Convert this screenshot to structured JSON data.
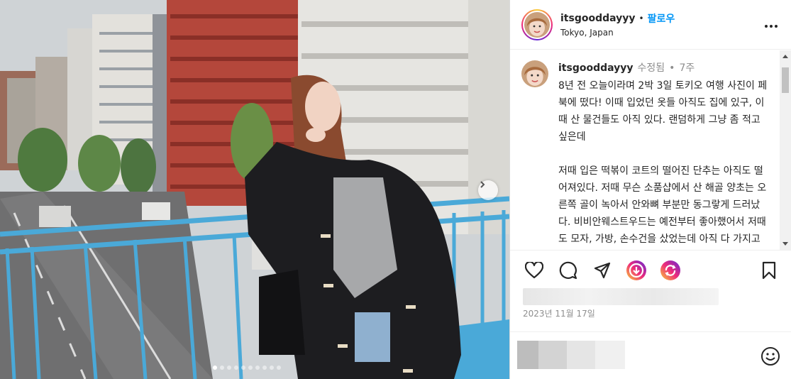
{
  "header": {
    "username": "itsgooddayyy",
    "separator": "•",
    "follow_label": "팔로우",
    "location": "Tokyo, Japan"
  },
  "caption": {
    "username": "itsgooddayyy",
    "edited_label": "수정됨",
    "separator": "•",
    "age": "7주",
    "text": "8년 전 오늘이라며 2박 3일 토키오 여행 사진이 페북에 떴다! 이때 입었던 옷들 아직도 집에 있구, 이때 산 물건들도 아직 있다. 랜덤하게 그냥 좀 적고 싶은데\n\n저때 입은 떡볶이 코트의 떨어진 단추는 아직도 떨어져있다. 저때 무슨 소품샵에서 산 해골 양초는 오른쪽 골이 녹아서 안와뼈 부분만 동그랗게 드러났다. 비비안웨스트우드는 예전부터 좋아했어서 저때도 모자, 가방, 손수건을 샀었는데 아직 다 가지고 있다."
  },
  "post": {
    "date": "2023년 11월 17일"
  },
  "carousel": {
    "total": 10,
    "active": 0
  },
  "icons": {
    "more": "more-horizontal-icon",
    "like": "heart-icon",
    "comment": "comment-icon",
    "share": "send-icon",
    "sticker1": "story-reshare-icon",
    "sticker2": "remix-icon",
    "save": "bookmark-icon",
    "emoji": "emoji-icon",
    "next": "chevron-right-icon"
  },
  "colors": {
    "follow": "#0095f6",
    "muted": "#8e8e8e",
    "text": "#262626",
    "railing": "#4aa9d8"
  }
}
